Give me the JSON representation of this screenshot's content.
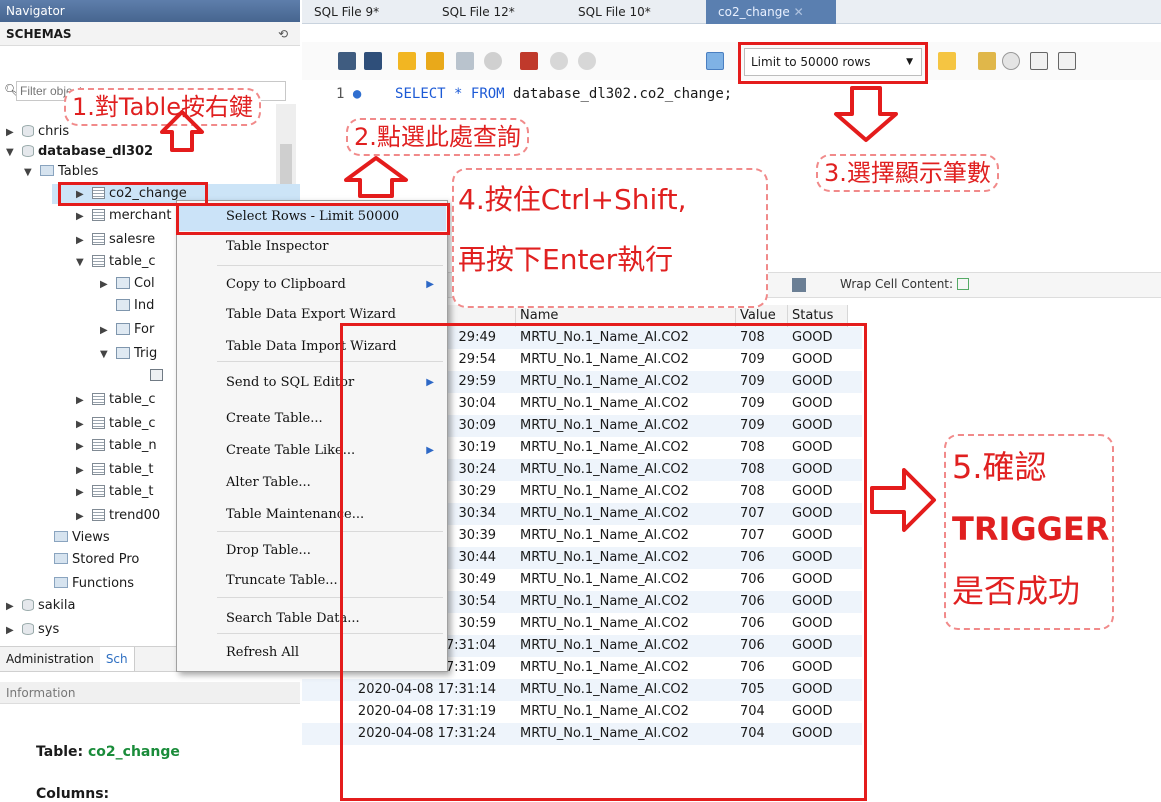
{
  "navigator": {
    "title": "Navigator",
    "schemas_label": "SCHEMAS",
    "filter_placeholder": "Filter objects",
    "tree": {
      "chris": "chris",
      "database": "database_dl302",
      "tables": "Tables",
      "co2_change": "co2_change",
      "merchant": "merchant",
      "salesre": "salesre",
      "table_c1": "table_c",
      "columns": "Col",
      "indexes": "Ind",
      "foreign": "For",
      "triggers": "Trig",
      "table_c2": "table_c",
      "table_c3": "table_c",
      "table_n": "table_n",
      "table_t1": "table_t",
      "table_t2": "table_t",
      "trend": "trend00",
      "views": "Views",
      "stored": "Stored Pro",
      "functions": "Functions",
      "sakila": "sakila",
      "sys": "sys"
    },
    "bottom_tabs": [
      "Administration",
      "Sch"
    ],
    "info_header": "Information",
    "info_table_label": "Table:",
    "info_table_name": "co2_change",
    "info_columns": "Columns:"
  },
  "editor_tabs": [
    "SQL File 9*",
    "SQL File 12*",
    "SQL File 10*",
    "co2_change"
  ],
  "limit_select": "Limit to 50000 rows",
  "sql": {
    "line_number": "1",
    "query_kw": "SELECT * FROM",
    "query_rest": " database_dl302.co2_change;"
  },
  "result_toolbar": {
    "wrap_label": "Wrap Cell Content:"
  },
  "grid": {
    "headers": [
      "Name",
      "Value",
      "Status"
    ],
    "rows": [
      [
        "29:49",
        "MRTU_No.1_Name_AI.CO2",
        "708",
        "GOOD"
      ],
      [
        "29:54",
        "MRTU_No.1_Name_AI.CO2",
        "709",
        "GOOD"
      ],
      [
        "29:59",
        "MRTU_No.1_Name_AI.CO2",
        "709",
        "GOOD"
      ],
      [
        "30:04",
        "MRTU_No.1_Name_AI.CO2",
        "709",
        "GOOD"
      ],
      [
        "30:09",
        "MRTU_No.1_Name_AI.CO2",
        "709",
        "GOOD"
      ],
      [
        "30:19",
        "MRTU_No.1_Name_AI.CO2",
        "708",
        "GOOD"
      ],
      [
        "30:24",
        "MRTU_No.1_Name_AI.CO2",
        "708",
        "GOOD"
      ],
      [
        "30:29",
        "MRTU_No.1_Name_AI.CO2",
        "708",
        "GOOD"
      ],
      [
        "30:34",
        "MRTU_No.1_Name_AI.CO2",
        "707",
        "GOOD"
      ],
      [
        "30:39",
        "MRTU_No.1_Name_AI.CO2",
        "707",
        "GOOD"
      ],
      [
        "30:44",
        "MRTU_No.1_Name_AI.CO2",
        "706",
        "GOOD"
      ],
      [
        "30:49",
        "MRTU_No.1_Name_AI.CO2",
        "706",
        "GOOD"
      ],
      [
        "30:54",
        "MRTU_No.1_Name_AI.CO2",
        "706",
        "GOOD"
      ],
      [
        "30:59",
        "MRTU_No.1_Name_AI.CO2",
        "706",
        "GOOD"
      ],
      [
        "2020-04-08 17:31:04",
        "MRTU_No.1_Name_AI.CO2",
        "706",
        "GOOD"
      ],
      [
        "2020-04-08 17:31:09",
        "MRTU_No.1_Name_AI.CO2",
        "706",
        "GOOD"
      ],
      [
        "2020-04-08 17:31:14",
        "MRTU_No.1_Name_AI.CO2",
        "705",
        "GOOD"
      ],
      [
        "2020-04-08 17:31:19",
        "MRTU_No.1_Name_AI.CO2",
        "704",
        "GOOD"
      ],
      [
        "2020-04-08 17:31:24",
        "MRTU_No.1_Name_AI.CO2",
        "704",
        "GOOD"
      ]
    ]
  },
  "context_menu": [
    {
      "label": "Select Rows - Limit 50000",
      "sub": false
    },
    {
      "label": "Table Inspector",
      "sub": false
    },
    {
      "label": "Copy to Clipboard",
      "sub": true
    },
    {
      "label": "Table Data Export Wizard",
      "sub": false
    },
    {
      "label": "Table Data Import Wizard",
      "sub": false
    },
    {
      "label": "Send to SQL Editor",
      "sub": true
    },
    {
      "label": "Create Table...",
      "sub": false
    },
    {
      "label": "Create Table Like...",
      "sub": true
    },
    {
      "label": "Alter Table...",
      "sub": false
    },
    {
      "label": "Table Maintenance...",
      "sub": false
    },
    {
      "label": "Drop Table...",
      "sub": false
    },
    {
      "label": "Truncate Table...",
      "sub": false
    },
    {
      "label": "Search Table Data...",
      "sub": false
    },
    {
      "label": "Refresh All",
      "sub": false
    }
  ],
  "annotations": {
    "step1": "1.對Table按右鍵",
    "step2": "2.點選此處查詢",
    "step3": "3.選擇顯示筆數",
    "step4_line1": "4.按住Ctrl+Shift,",
    "step4_line2": "再按下Enter執行",
    "step5_line1": "5.確認",
    "step5_line2": "TRIGGER",
    "step5_line3": "是否成功"
  },
  "colors": {
    "annotation_red": "#e41c1c",
    "nav_header": "#4d6d99",
    "selection": "#cce4f7",
    "active_tab": "#5a7fb0"
  }
}
